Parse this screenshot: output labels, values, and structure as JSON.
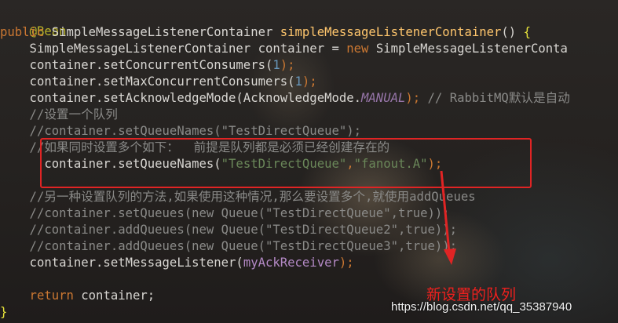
{
  "code": {
    "l1": {
      "text": "@Bean"
    },
    "l2": {
      "kw": "public ",
      "type": "SimpleMessageListenerContainer ",
      "fn": "simpleMessageListenerContainer",
      "rest": "() ",
      "brace": "{"
    },
    "l3": {
      "a": "    SimpleMessageListenerContainer container = ",
      "kw": "new ",
      "b": "SimpleMessageListenerConta"
    },
    "l4": {
      "a": "    container.setConcurrentConsumers(",
      "num": "1",
      "b": ");"
    },
    "l5": {
      "a": "    container.setMaxConcurrentConsumers(",
      "num": "1",
      "b": ");"
    },
    "l6": {
      "a": "    container.setAcknowledgeMode(AcknowledgeMode.",
      "field": "MANUAL",
      "b": "); ",
      "cmt": "// RabbitMQ默认是自动"
    },
    "l7": {
      "cmt": "    //设置一个队列"
    },
    "l8": {
      "cmt": "    //container.setQueueNames(\"TestDirectQueue\");"
    },
    "l9": {
      "cmt": "    //如果同时设置多个如下：  前提是队列都是必须已经创建存在的"
    },
    "l10": {
      "a": "      container.setQueueNames(",
      "s1": "\"TestDirectQueue\"",
      "comma": ",",
      "s2": "\"fanout.A\"",
      "b": ");"
    },
    "l12": {
      "cmt": "    //另一种设置队列的方法,如果使用这种情况,那么要设置多个,就使用addQueues"
    },
    "l13": {
      "cmt": "    //container.setQueues(new Queue(\"TestDirectQueue\",true));"
    },
    "l14": {
      "cmt": "    //container.addQueues(new Queue(\"TestDirectQueue2\",true));"
    },
    "l15": {
      "cmt": "    //container.addQueues(new Queue(\"TestDirectQueue3\",true));"
    },
    "l16": {
      "a": "    container.setMessageListener(",
      "param": "myAckReceiver",
      "b": ");"
    },
    "l18": {
      "kw": "    return ",
      "a": "container;"
    },
    "l19": {
      "brace": "}"
    }
  },
  "annotation": {
    "caption": "新设置的队列",
    "highlight_color": "#e02424"
  },
  "watermark": "https://blog.csdn.net/qq_35387940",
  "colors": {
    "keyword": "#cc7832",
    "string": "#6a8759",
    "number": "#6897bb",
    "comment": "#8a8a88",
    "function": "#ffc66d",
    "annotation": "#bbb529"
  }
}
